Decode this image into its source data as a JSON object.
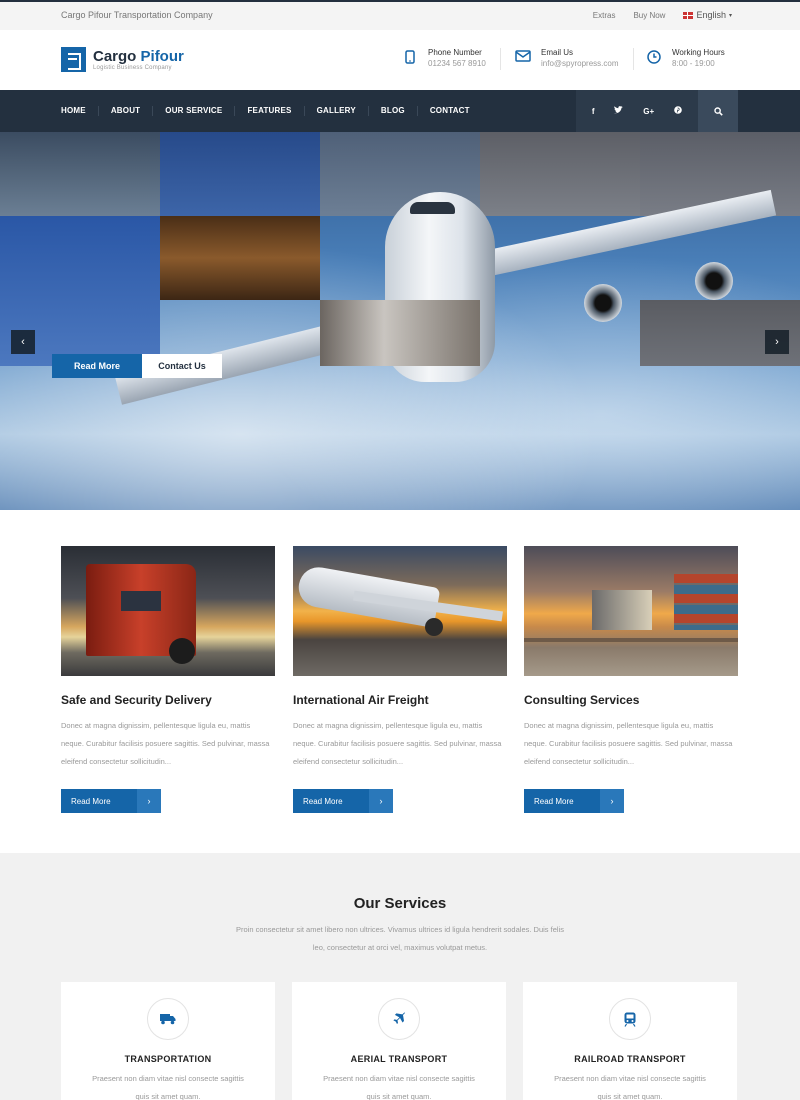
{
  "topbar": {
    "company": "Cargo Pifour Transportation Company",
    "links": [
      "Extras",
      "Buy Now"
    ],
    "language": "English"
  },
  "header": {
    "logo_name_1": "Cargo",
    "logo_name_2": "Pifour",
    "logo_sub": "Logistic Business Company",
    "phone_label": "Phone Number",
    "phone_value": "01234 567 8910",
    "email_label": "Email Us",
    "email_value": "info@spyropress.com",
    "hours_label": "Working Hours",
    "hours_value": "8:00 - 19:00"
  },
  "nav": {
    "items": [
      "HOME",
      "ABOUT",
      "OUR SERVICE",
      "FEATURES",
      "GALLERY",
      "BLOG",
      "CONTACT"
    ],
    "social": [
      "f",
      "t",
      "G+",
      "p"
    ]
  },
  "hero": {
    "btn_read_more": "Read More",
    "btn_contact": "Contact Us"
  },
  "features": [
    {
      "title": "Safe and Security Delivery",
      "text": "Donec at magna dignissim, pellentesque ligula eu, mattis neque. Curabitur facilisis posuere sagittis. Sed pulvinar, massa eleifend consectetur sollicitudin...",
      "button": "Read More"
    },
    {
      "title": "International Air Freight",
      "text": "Donec at magna dignissim, pellentesque ligula eu, mattis neque. Curabitur facilisis posuere sagittis. Sed pulvinar, massa eleifend consectetur sollicitudin...",
      "button": "Read More"
    },
    {
      "title": "Consulting Services",
      "text": "Donec at magna dignissim, pellentesque ligula eu, mattis neque. Curabitur facilisis posuere sagittis. Sed pulvinar, massa eleifend consectetur sollicitudin...",
      "button": "Read More"
    }
  ],
  "services": {
    "title": "Our Services",
    "intro": "Proin consectetur sit amet libero non ultrices. Vivamus ultrices id ligula hendrerit sodales. Duis felis leo, consectetur at orci vel, maximus volutpat metus.",
    "items": [
      {
        "title": "TRANSPORTATION",
        "text": "Praesent non diam vitae nisl consecte sagittis quis sit amet quam.",
        "icon": "truck-icon"
      },
      {
        "title": "AERIAL TRANSPORT",
        "text": "Praesent non diam vitae nisl consecte sagittis quis sit amet quam.",
        "icon": "plane-icon"
      },
      {
        "title": "RAILROAD TRANSPORT",
        "text": "Praesent non diam vitae nisl consecte sagittis quis sit amet quam.",
        "icon": "train-icon"
      }
    ]
  },
  "colors": {
    "brand_blue": "#1565a8",
    "nav_dark": "#23303f"
  }
}
